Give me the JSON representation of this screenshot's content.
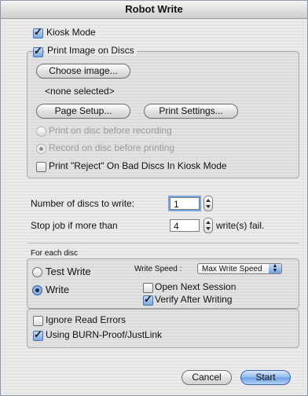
{
  "window": {
    "title": "Robot Write"
  },
  "kiosk": {
    "label": "Kiosk Mode",
    "checked": true
  },
  "print_image": {
    "label": "Print Image on Discs",
    "checked": true,
    "choose_label": "Choose image...",
    "selection": "<none selected>",
    "page_setup_label": "Page Setup...",
    "print_settings_label": "Print Settings...",
    "option_print_first": "Print on disc before recording",
    "option_record_first": "Record on disc before printing",
    "reject_label": "Print \"Reject\" On Bad Discs In Kiosk Mode",
    "reject_checked": false
  },
  "job": {
    "discs_label": "Number of discs to write:",
    "discs_value": "1",
    "stop_label": "Stop job if more than",
    "stop_value": "4",
    "stop_suffix": "write(s) fail."
  },
  "each_disc": {
    "heading": "For each disc",
    "test_write_label": "Test Write",
    "write_label": "Write",
    "write_speed_label": "Write Speed :",
    "write_speed_value": "Max Write Speed",
    "open_next_session_label": "Open Next Session",
    "open_next_session_checked": false,
    "verify_label": "Verify After Writing",
    "verify_checked": true,
    "ignore_errors_label": "Ignore Read Errors",
    "ignore_errors_checked": false,
    "burnproof_label": "Using BURN-Proof/JustLink",
    "burnproof_checked": true
  },
  "buttons": {
    "cancel_label": "Cancel",
    "start_label": "Start"
  },
  "icons": {
    "checkbox": "checkmark-icon",
    "radio": "radio-dot-icon",
    "stepper": "stepper-arrows-icon",
    "popup": "popup-arrows-icon"
  },
  "colors": {
    "accent": "#6aa0e6",
    "window_bg": "#ececec"
  }
}
